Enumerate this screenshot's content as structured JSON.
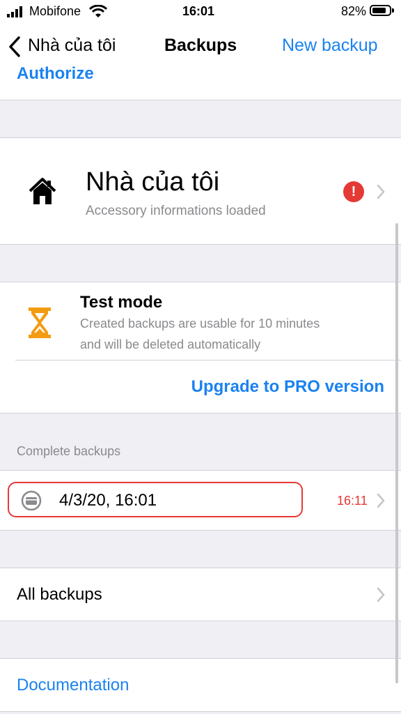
{
  "status_bar": {
    "carrier": "Mobifone",
    "time": "16:01",
    "battery_percent": "82%",
    "battery_level": 0.82
  },
  "nav": {
    "back_label": "Nhà của tôi",
    "title": "Backups",
    "action_label": "New backup",
    "authorize_label": "Authorize"
  },
  "home_card": {
    "name": "Nhà của tôi",
    "status": "Accessory informations loaded",
    "icon": "house-icon",
    "alert_icon": "exclamation-icon",
    "alert_color": "#e53935"
  },
  "test_mode": {
    "icon": "hourglass-icon",
    "icon_color": "#f39c12",
    "title": "Test mode",
    "line1": "Created backups are usable for 10 minutes",
    "line2": "and will be deleted automatically",
    "upgrade_label": "Upgrade to PRO version"
  },
  "complete_backups": {
    "header": "Complete backups",
    "items": [
      {
        "date": "4/3/20, 16:01",
        "expires": "16:11",
        "icon": "backup-box-icon"
      }
    ]
  },
  "all_backups": {
    "label": "All backups"
  },
  "documentation": {
    "label": "Documentation"
  },
  "colors": {
    "accent": "#1a82f0",
    "background": "#efeff4",
    "separator": "#d1d1d6",
    "highlight_border": "#e53935"
  }
}
